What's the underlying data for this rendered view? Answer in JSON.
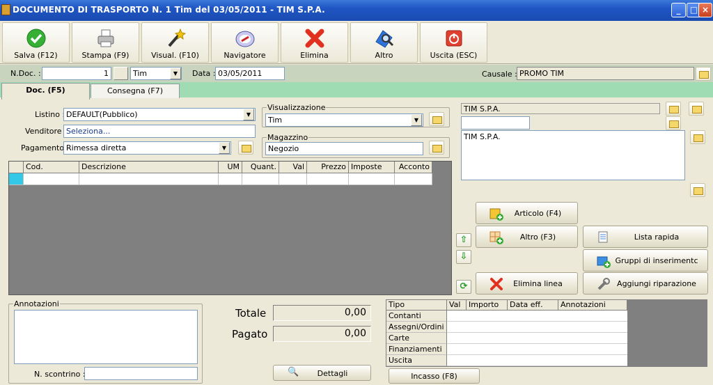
{
  "window": {
    "title": "DOCUMENTO DI TRASPORTO N. 1 Tim del 03/05/2011 - TIM S.P.A."
  },
  "toolbar": [
    {
      "label": "Salva (F12)",
      "icon": "check-icon"
    },
    {
      "label": "Stampa (F9)",
      "icon": "printer-icon"
    },
    {
      "label": "Visual. (F10)",
      "icon": "magic-wand-icon"
    },
    {
      "label": "Navigatore",
      "icon": "compass-icon"
    },
    {
      "label": "Elimina",
      "icon": "red-x-icon"
    },
    {
      "label": "Altro",
      "icon": "search-icon"
    },
    {
      "label": "Uscita (ESC)",
      "icon": "power-icon"
    }
  ],
  "docbar": {
    "ndoc_label": "N.Doc. :",
    "ndoc_value": "1",
    "serie_value": "Tim",
    "data_label": "Data :",
    "data_value": "03/05/2011",
    "causale_label": "Causale :",
    "causale_value": "PROMO TIM"
  },
  "tabs": [
    {
      "label": "Doc. (F5)"
    },
    {
      "label": "Consegna (F7)"
    }
  ],
  "form": {
    "listino_label": "Listino :",
    "listino_value": "DEFAULT(Pubblico)",
    "venditore_label": "Venditore :",
    "venditore_value": "Seleziona...",
    "pagamento_label": "Pagamento :",
    "pagamento_value": "Rimessa diretta",
    "visualizzazione_label": "Visualizzazione",
    "visualizzazione_value": "Tim",
    "magazzino_label": "Magazzino",
    "magazzino_value": "Negozio"
  },
  "customer": {
    "name": "TIM S.P.A.",
    "address_text": "TIM S.P.A."
  },
  "grid": {
    "columns": [
      "Cod.",
      "Descrizione",
      "UM",
      "Quant.",
      "Val",
      "Prezzo",
      "Imposte",
      "Acconto"
    ]
  },
  "actions": {
    "articolo": "Articolo (F4)",
    "altro": "Altro (F3)",
    "lista_rapida": "Lista rapida",
    "gruppi": "Gruppi di inserimentc",
    "elimina_linea": "Elimina linea",
    "riparazione": "Aggiungi riparazione"
  },
  "bottom": {
    "annotazioni_label": "Annotazioni",
    "scontrino_label": "N. scontrino :",
    "totale_label": "Totale",
    "totale_value": "0,00",
    "pagato_label": "Pagato",
    "pagato_value": "0,00",
    "dettagli": "Dettagli",
    "incasso": "Incasso (F8)"
  },
  "payments": {
    "columns": [
      "Tipo",
      "Val",
      "Importo",
      "Data eff.",
      "Annotazioni"
    ],
    "rows": [
      "Contanti",
      "Assegni/Ordini",
      "Carte",
      "Finanziamenti",
      "Uscita"
    ]
  }
}
